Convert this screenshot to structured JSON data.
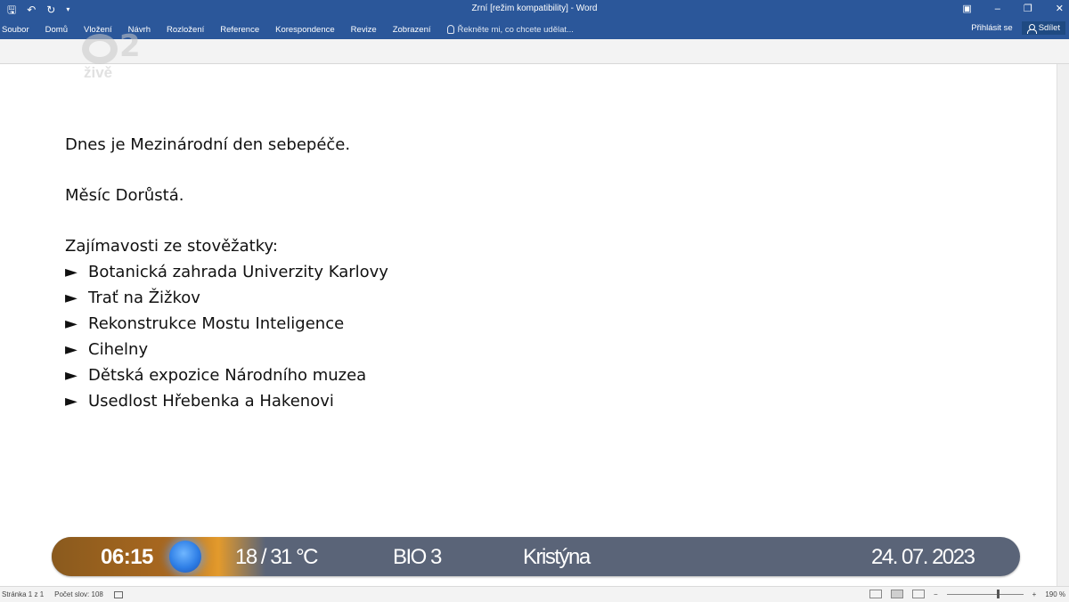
{
  "titlebar": {
    "title": "Zrní [režim kompatibility] - Word",
    "qat_icons": [
      "save-icon",
      "undo-icon",
      "redo-icon",
      "customize-icon"
    ],
    "window_controls": [
      "ribbon-display-icon",
      "minimize-icon",
      "restore-icon",
      "close-icon"
    ]
  },
  "ribbon": {
    "tabs": [
      {
        "label": "Soubor"
      },
      {
        "label": "Domů"
      },
      {
        "label": "Vložení"
      },
      {
        "label": "Návrh"
      },
      {
        "label": "Rozložení"
      },
      {
        "label": "Reference"
      },
      {
        "label": "Korespondence"
      },
      {
        "label": "Revize"
      },
      {
        "label": "Zobrazení"
      }
    ],
    "tell_me": "Řekněte mi, co chcete udělat...",
    "sign_in": "Přihlásit se",
    "share": "Sdílet"
  },
  "watermark": {
    "channel": "2",
    "live": "živě"
  },
  "document": {
    "line1": "Dnes je Mezinárodní den sebepéče.",
    "line2": "Měsíc Dorůstá.",
    "list_heading": "Zajímavosti ze stověžatky:",
    "bullet_glyph": "►",
    "items": [
      "Botanická zahrada Univerzity Karlovy",
      "Trať na Žižkov",
      "Rekonstrukce Mostu Inteligence",
      "Cihelny",
      "Dětská expozice Národního muzea",
      "Usedlost Hřebenka a Hakenovi"
    ]
  },
  "statusbar": {
    "page": "Stránka 1 z 1",
    "words": "Počet slov: 108",
    "zoom_minus": "−",
    "zoom_plus": "+",
    "zoom": "190 %"
  },
  "tvbar": {
    "time": "06:15",
    "temperature": "18 / 31 °C",
    "channel": "BIO 3",
    "name": "Kristýna",
    "date": "24. 07. 2023"
  },
  "colors": {
    "word_blue": "#2b579a",
    "tvbar_bg": "#5a6478",
    "tvbar_orange": "#a9681f",
    "sun_blue": "#2f7fe6"
  }
}
